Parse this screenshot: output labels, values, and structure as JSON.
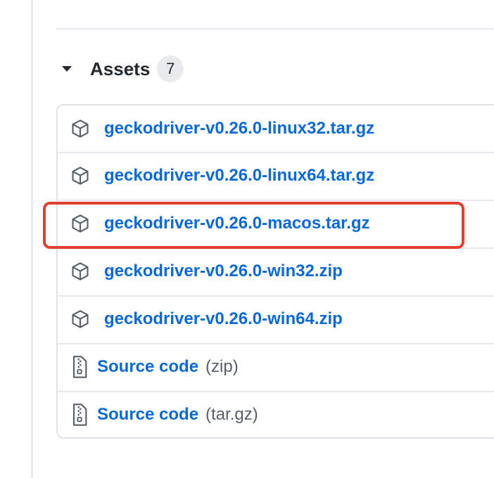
{
  "assets": {
    "title": "Assets",
    "count": "7",
    "packages": [
      {
        "name": "geckodriver-v0.26.0-linux32.tar.gz"
      },
      {
        "name": "geckodriver-v0.26.0-linux64.tar.gz"
      },
      {
        "name": "geckodriver-v0.26.0-macos.tar.gz",
        "highlighted": true
      },
      {
        "name": "geckodriver-v0.26.0-win32.zip"
      },
      {
        "name": "geckodriver-v0.26.0-win64.zip"
      }
    ],
    "source": [
      {
        "label": "Source code",
        "suffix": "(zip)"
      },
      {
        "label": "Source code",
        "suffix": "(tar.gz)"
      }
    ]
  },
  "colors": {
    "link": "#0969da",
    "highlight": "#e2402f",
    "icon": "#57606a"
  },
  "icons": {
    "caret": "triangle-down-icon",
    "package": "package-icon",
    "zip": "file-zip-icon"
  }
}
